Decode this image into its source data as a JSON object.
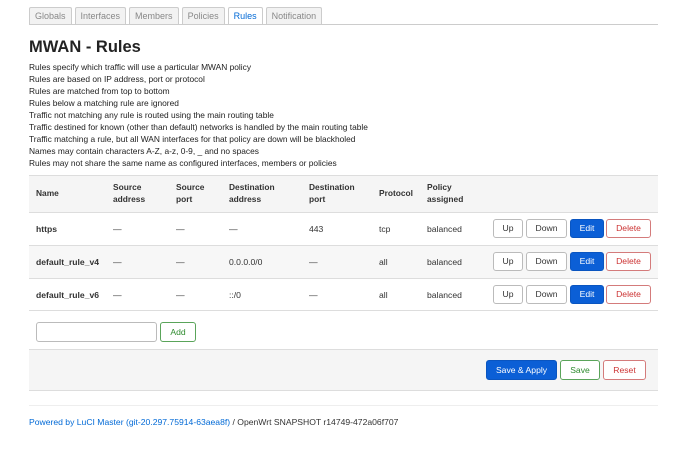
{
  "tabs": [
    "Globals",
    "Interfaces",
    "Members",
    "Policies",
    "Rules",
    "Notification"
  ],
  "page": {
    "title": "MWAN - Rules",
    "description": [
      "Rules specify which traffic will use a particular MWAN policy",
      "Rules are based on IP address, port or protocol",
      "Rules are matched from top to bottom",
      "Rules below a matching rule are ignored",
      "Traffic not matching any rule is routed using the main routing table",
      "Traffic destined for known (other than default) networks is handled by the main routing table",
      "Traffic matching a rule, but all WAN interfaces for that policy are down will be blackholed",
      "Names may contain characters A-Z, a-z, 0-9, _ and no spaces",
      "Rules may not share the same name as configured interfaces, members or policies"
    ]
  },
  "table": {
    "headers": {
      "name": "Name",
      "src_addr_1": "Source",
      "src_addr_2": "address",
      "src_port_1": "Source",
      "src_port_2": "port",
      "dst_addr_1": "Destination",
      "dst_addr_2": "address",
      "dst_port_1": "Destination",
      "dst_port_2": "port",
      "protocol": "Protocol",
      "policy_1": "Policy",
      "policy_2": "assigned"
    },
    "rows": [
      {
        "name": "https",
        "src_addr": "—",
        "src_port": "—",
        "dst_addr": "—",
        "dst_port": "443",
        "protocol": "tcp",
        "policy": "balanced"
      },
      {
        "name": "default_rule_v4",
        "src_addr": "—",
        "src_port": "—",
        "dst_addr": "0.0.0.0/0",
        "dst_port": "—",
        "protocol": "all",
        "policy": "balanced"
      },
      {
        "name": "default_rule_v6",
        "src_addr": "—",
        "src_port": "—",
        "dst_addr": "::/0",
        "dst_port": "—",
        "protocol": "all",
        "policy": "balanced"
      }
    ],
    "row_buttons": {
      "up": "Up",
      "down": "Down",
      "edit": "Edit",
      "delete": "Delete"
    }
  },
  "add": {
    "input_value": "",
    "button": "Add"
  },
  "actions": {
    "save_apply": "Save & Apply",
    "save": "Save",
    "reset": "Reset"
  },
  "footer": {
    "link": "Powered by LuCI Master (git-20.297.75914-63aea8f)",
    "text": " / OpenWrt SNAPSHOT r14749-472a06f707"
  },
  "colors": {
    "accent": "#0b5fd6",
    "positive": "#2e8b2e",
    "negative": "#cc3333"
  }
}
